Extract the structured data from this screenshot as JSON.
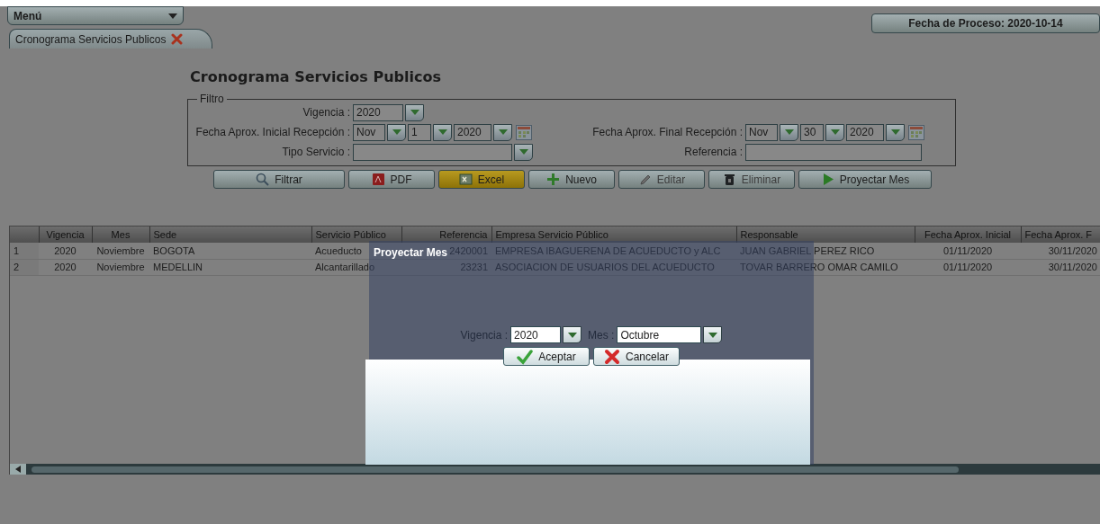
{
  "menu": {
    "label": "Menú"
  },
  "process_date": "Fecha de Proceso: 2020-10-14",
  "tabs": [
    {
      "label": "Cronograma Servicios Publicos",
      "selected": true
    }
  ],
  "page_title": "Cronograma Servicios Publicos",
  "filter": {
    "legend": "Filtro",
    "vigencia": {
      "label": "Vigencia :",
      "value": "2020"
    },
    "fecha_inicial": {
      "label": "Fecha Aprox. Inicial Recepción :",
      "month": "Nov",
      "day": "1",
      "year": "2020"
    },
    "fecha_final": {
      "label": "Fecha Aprox. Final Recepción :",
      "month": "Nov",
      "day": "30",
      "year": "2020"
    },
    "tipo_servicio": {
      "label": "Tipo Servicio :"
    },
    "referencia": {
      "label": "Referencia :"
    }
  },
  "toolbar": [
    {
      "label": "Filtrar",
      "highlighted": false,
      "disabled": false
    },
    {
      "label": "PDF",
      "highlighted": false,
      "disabled": false
    },
    {
      "label": "Excel",
      "highlighted": true,
      "disabled": false
    },
    {
      "label": "Nuevo",
      "highlighted": false,
      "disabled": false
    },
    {
      "label": "Editar",
      "highlighted": false,
      "disabled": true
    },
    {
      "label": "Eliminar",
      "highlighted": false,
      "disabled": true
    },
    {
      "label": "Proyectar Mes",
      "highlighted": false,
      "disabled": false
    }
  ],
  "table": {
    "columns": [
      "Vigencia",
      "Mes",
      "Sede",
      "Servicio Público",
      "Referencia",
      "Empresa Servicio Público",
      "Responsable",
      "Fecha Aprox. Inicial",
      "Fecha Aprox. F"
    ],
    "rows": [
      {
        "number": "1",
        "cells": [
          "2020",
          "Noviembre",
          "BOGOTA",
          "Acueducto",
          "2420001",
          "EMPRESA IBAGUERENA DE ACUEDUCTO y ALC",
          "JUAN GABRIEL PEREZ RICO",
          "01/11/2020",
          "30/11/2020"
        ]
      },
      {
        "number": "2",
        "cells": [
          "2020",
          "Noviembre",
          "MEDELLIN",
          "Alcantarillado",
          "23231",
          "ASOCIACION DE USUARIOS DEL ACUEDUCTO",
          "TOVAR BARRERO OMAR CAMILO",
          "01/11/2020",
          "30/11/2020"
        ]
      }
    ]
  },
  "dialog": {
    "title": "Proyectar Mes",
    "vigencia": {
      "label": "Vigencia :",
      "value": "2020"
    },
    "mes": {
      "label": "Mes :",
      "value": "Octubre"
    },
    "buttons": [
      "Aceptar",
      "Cancelar"
    ]
  }
}
